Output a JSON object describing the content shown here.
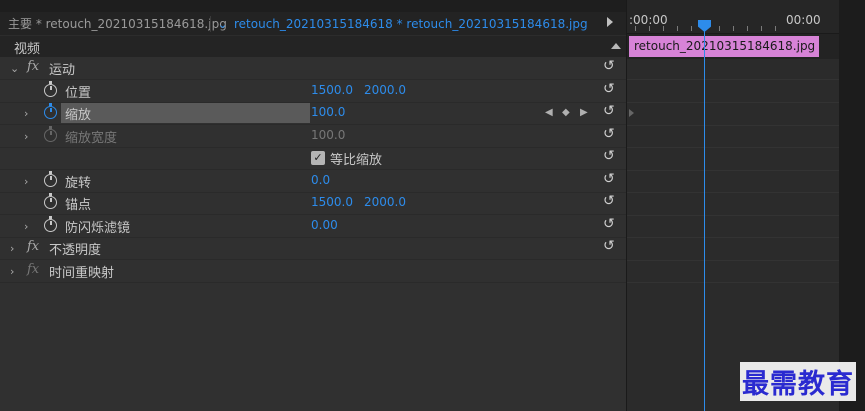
{
  "tabs": {
    "master": "主要 * retouch_20210315184618.jpg",
    "clip": "retouch_20210315184618 * retouch_20210315184618.jpg"
  },
  "section": {
    "video": "视频"
  },
  "effects": [
    {
      "id": "motion",
      "twirl": "open",
      "fx": "fx",
      "name": "运动"
    },
    {
      "id": "position",
      "name": "位置",
      "values": [
        "1500.0",
        "2000.0"
      ]
    },
    {
      "id": "scale",
      "twirl": "closed",
      "name": "缩放",
      "values": [
        "100.0"
      ]
    },
    {
      "id": "scale-width",
      "twirl": "closed",
      "name": "缩放宽度",
      "values": [
        "100.0"
      ]
    },
    {
      "id": "uniform-scale",
      "name": "等比缩放",
      "checked": true
    },
    {
      "id": "rotation",
      "twirl": "closed",
      "name": "旋转",
      "values": [
        "0.0"
      ]
    },
    {
      "id": "anchor",
      "name": "锚点",
      "values": [
        "1500.0",
        "2000.0"
      ]
    },
    {
      "id": "anti-flicker",
      "twirl": "closed",
      "name": "防闪烁滤镜",
      "values": [
        "0.00"
      ]
    },
    {
      "id": "opacity",
      "twirl": "closed",
      "fx": "fx",
      "name": "不透明度"
    },
    {
      "id": "time-remap",
      "twirl": "closed",
      "fx": "fx",
      "name": "时间重映射"
    }
  ],
  "timeline": {
    "ruler_start": ":00:00",
    "ruler_end": "00:00",
    "clip_label": "retouch_20210315184618.jpg",
    "clip_color": "#d783d7",
    "playhead_color": "#2d8ceb"
  },
  "icons": {
    "twirl_open": "chevron-down-icon",
    "twirl_closed": "chevron-right-icon",
    "stopwatch": "stopwatch-icon",
    "reset": "reset-icon",
    "prev_keyframe": "prev-keyframe-icon",
    "add_keyframe": "add-keyframe-icon",
    "next_keyframe": "next-keyframe-icon"
  },
  "glyphs": {
    "down": "⌄",
    "right": "›",
    "reset": "↺",
    "prev": "◀",
    "add": "◆",
    "next": "▶",
    "check": "✓",
    "tab_chevron": "⌄"
  },
  "watermark": "最需教育"
}
